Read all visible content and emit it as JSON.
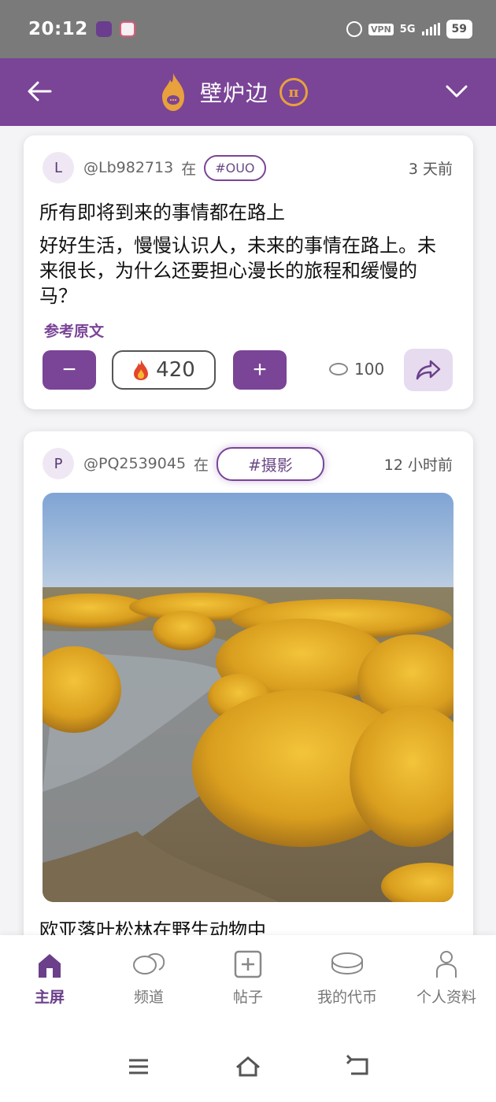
{
  "status_bar": {
    "time": "20:12",
    "vpn": "VPN",
    "network": "5G",
    "battery": "59"
  },
  "header": {
    "title": "壁炉边",
    "coin_symbol": "π"
  },
  "posts": [
    {
      "avatar_letter": "L",
      "username": "@Lb982713",
      "in_word": "在",
      "channel": "#OUO",
      "time": "3 天前",
      "title": "所有即将到来的事情都在路上",
      "body": "好好生活，慢慢认识人，未来的事情在路上。未来很长，为什么还要担心漫长的旅程和缓慢的马？",
      "ref_link": "参考原文",
      "score": "420",
      "coins": "100",
      "minus_label": "−",
      "plus_label": "+"
    },
    {
      "avatar_letter": "P",
      "username": "@PQ2539045",
      "in_word": "在",
      "channel": "#摄影",
      "time": "12 小时前",
      "title": "欧亚落叶松林在野生动物中"
    }
  ],
  "bottom_nav": {
    "items": [
      {
        "label": "主屏",
        "icon": "home-icon",
        "active": true
      },
      {
        "label": "频道",
        "icon": "chat-bubbles-icon"
      },
      {
        "label": "帖子",
        "icon": "plus-square-icon"
      },
      {
        "label": "我的代币",
        "icon": "coin-stack-icon"
      },
      {
        "label": "个人资料",
        "icon": "person-icon"
      }
    ]
  },
  "colors": {
    "brand_purple": "#7a4497",
    "accent_orange": "#e8a13c"
  }
}
